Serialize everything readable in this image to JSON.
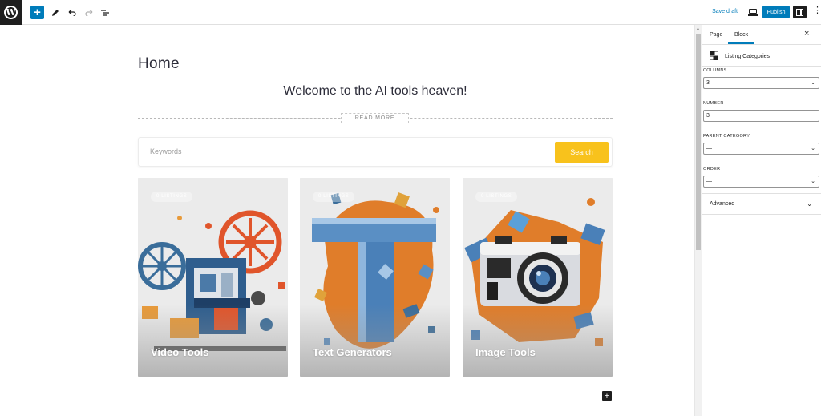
{
  "toolbar": {
    "save_draft": "Save draft",
    "publish": "Publish"
  },
  "editor": {
    "page_title": "Home",
    "welcome": "Welcome to the AI tools heaven!",
    "read_more": "READ MORE",
    "search": {
      "placeholder": "Keywords",
      "button": "Search",
      "button_color": "#f8c21c"
    },
    "cards": [
      {
        "title": "Video Tools",
        "badge": "0 LISTINGS"
      },
      {
        "title": "Text Generators",
        "badge": "0 LISTINGS"
      },
      {
        "title": "Image Tools",
        "badge": "0 LISTINGS"
      }
    ]
  },
  "sidebar": {
    "tabs": [
      "Page",
      "Block"
    ],
    "block_name": "Listing Categories",
    "columns_label": "COLUMNS",
    "columns_value": "3",
    "number_label": "NUMBER",
    "number_value": "3",
    "parent_label": "PARENT CATEGORY",
    "parent_value": "—",
    "order_label": "ORDER",
    "order_value": "—",
    "advanced": "Advanced"
  },
  "colors": {
    "accent": "#007cba",
    "dark": "#1e1e1e"
  }
}
